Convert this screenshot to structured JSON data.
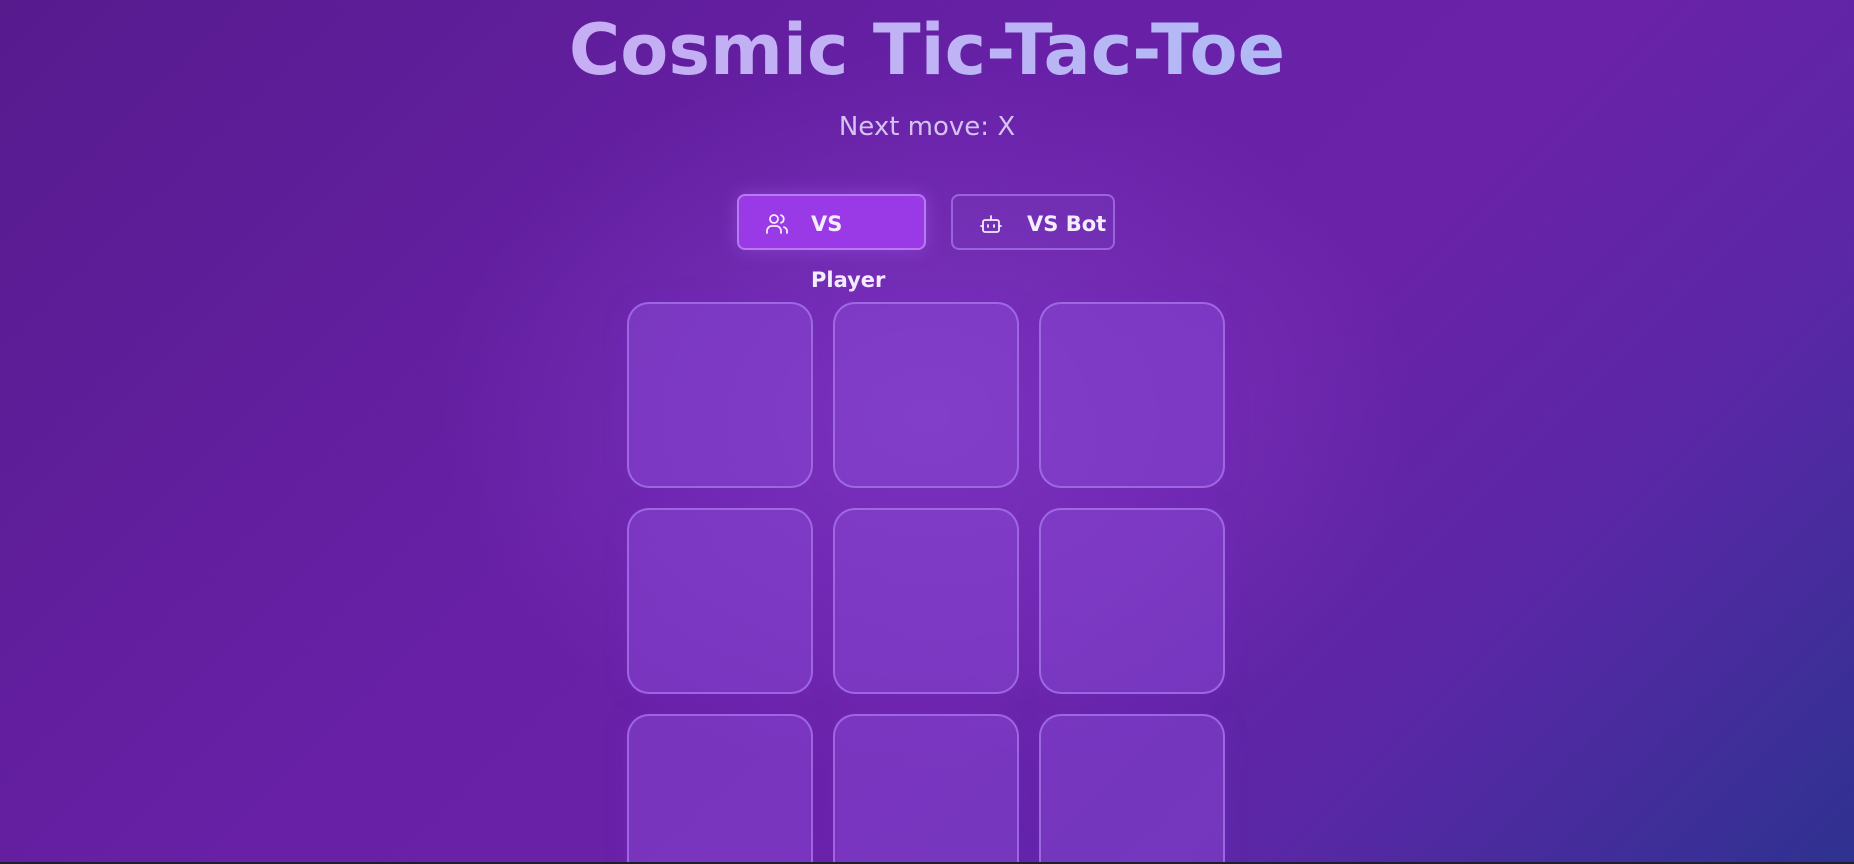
{
  "game": {
    "title": "Cosmic Tic-Tac-Toe",
    "status": "Next move: X"
  },
  "modes": [
    {
      "label": "VS Player",
      "icon": "users-icon",
      "selected": true
    },
    {
      "label": "VS Bot",
      "icon": "bot-icon",
      "selected": false
    }
  ],
  "board": {
    "cells": [
      "",
      "",
      "",
      "",
      "",
      "",
      "",
      "",
      ""
    ]
  },
  "colors": {
    "accent": "#9a3ae6",
    "title_gradient_start": "#d1a3f2",
    "title_gradient_end": "#9bc7f8",
    "background_start": "#571b8e",
    "background_end": "#2e3290"
  }
}
